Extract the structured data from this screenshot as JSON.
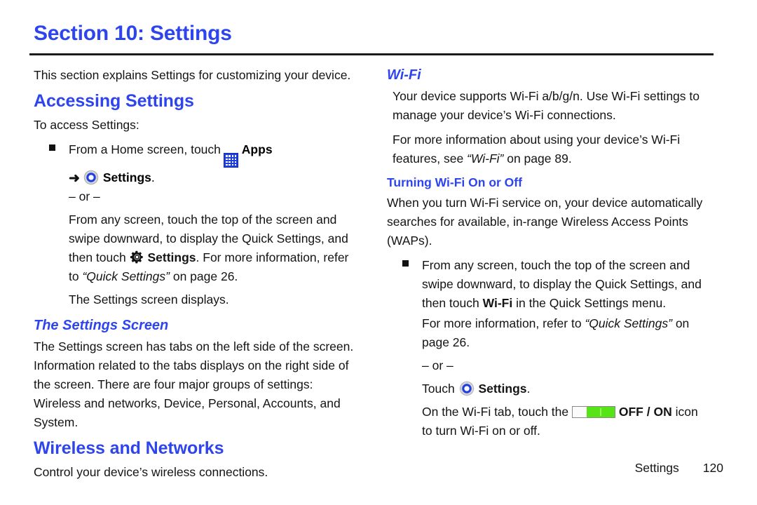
{
  "document": {
    "section_title": "Section 10: Settings",
    "intro": "This section explains Settings for customizing your device."
  },
  "left_column": {
    "heading_accessing": "Accessing Settings",
    "to_access": "To access Settings:",
    "bullet_1": {
      "text_before_icon": "From a Home screen, touch",
      "apps_icon": "apps-grid-icon",
      "apps_label": "Apps",
      "arrow": "➜",
      "settings_icon": "settings-gear-icon",
      "settings_label": "Settings",
      "period": "."
    },
    "or_1": "– or –",
    "para_quick_a": "From any screen, touch the top of the screen and swipe downward, to display the Quick Settings, and then touch",
    "quick_gear_icon": "settings-gear-black-icon",
    "quick_settings_bold": "Settings",
    "para_quick_b": ". For more information, refer to",
    "quick_settings_ref": "“Quick Settings”",
    "para_quick_c": "on page 26.",
    "settings_displays": "The Settings screen displays.",
    "heading_settings_screen": "The Settings Screen",
    "settings_screen_body": "The Settings screen has tabs on the left side of the screen. Information related to the tabs displays on the right side of the screen. There are four major groups of settings: Wireless and networks, Device, Personal, Accounts, and System.",
    "heading_wireless": "Wireless and Networks",
    "wireless_body": "Control your device’s wireless connections."
  },
  "right_column": {
    "heading_wifi": "Wi-Fi",
    "wifi_para_1": "Your device supports Wi-Fi a/b/g/n. Use Wi-Fi settings to manage your device’s Wi-Fi connections.",
    "wifi_para_2a": "For more information about using your device’s Wi-Fi features, see",
    "wifi_ref": "“Wi-Fi”",
    "wifi_para_2b": "on page 89.",
    "heading_turning": "Turning Wi-Fi On or Off",
    "turning_body": "When you turn Wi-Fi service on, your device automatically searches for available, in-range Wireless Access Points (WAPs).",
    "bullet_1": {
      "text_a": "From any screen, touch the top of the screen and swipe downward, to display the Quick Settings, and then touch",
      "wifi_bold": "Wi-Fi",
      "text_b": "in the Quick Settings menu."
    },
    "more_info_a": "For more information, refer to",
    "more_info_ref": "“Quick Settings”",
    "more_info_b": "on page 26.",
    "or_2": "– or –",
    "touch_label": "Touch",
    "touch_settings_icon": "settings-gear-icon",
    "touch_settings_bold": "Settings",
    "touch_period": ".",
    "toggle_line_a": "On the Wi-Fi tab, touch the",
    "toggle_icon": "off-on-toggle-icon",
    "toggle_label": "OFF / ON",
    "toggle_line_b": "icon to turn Wi-Fi on or off."
  },
  "footer": {
    "section_label": "Settings",
    "page_number": "120"
  },
  "colors": {
    "heading_blue": "#2e45ee",
    "toggle_green": "#57e416",
    "apps_icon_blue": "#1f3fe0",
    "text_black": "#141414"
  }
}
